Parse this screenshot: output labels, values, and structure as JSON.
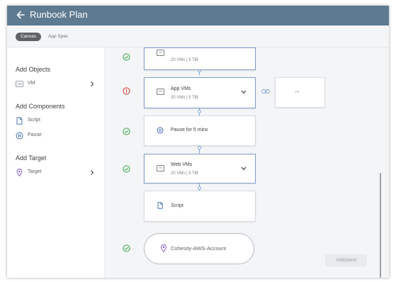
{
  "header": {
    "title": "Runbook Plan"
  },
  "tabs": [
    {
      "label": "Canvas",
      "active": true
    },
    {
      "label": "App Spec",
      "active": false
    }
  ],
  "sidebar": {
    "sections": [
      {
        "title": "Add Objects",
        "items": [
          {
            "label": "VM",
            "icon": "vm-icon",
            "has_chevron": true
          }
        ]
      },
      {
        "title": "Add Components",
        "items": [
          {
            "label": "Script",
            "icon": "script-file-icon"
          },
          {
            "label": "Pause",
            "icon": "pause-icon"
          }
        ]
      },
      {
        "title": "Add Target",
        "items": [
          {
            "label": "Target",
            "icon": "location-pin-icon",
            "has_chevron": true
          }
        ]
      }
    ]
  },
  "canvas": {
    "nodes": [
      {
        "title": "",
        "meta": "20 VMs  |  5 TiB",
        "status": "success",
        "icon": "vm-icon"
      },
      {
        "title": "App VMs",
        "meta": "20 VMs  |  5 TiB",
        "status": "error",
        "icon": "vm-icon",
        "expandable": true,
        "linked": true
      },
      {
        "title": "Pause for 5 mins",
        "meta": "",
        "status": "success",
        "icon": "pause-icon"
      },
      {
        "title": "Web VMs",
        "meta": "20 VMs  |  5 TiB",
        "status": "success",
        "icon": "vm-icon",
        "expandable": true
      },
      {
        "title": "Script",
        "meta": "",
        "status": "none",
        "icon": "script-file-icon"
      },
      {
        "title": "Cohesity-AWS-Account",
        "meta": "",
        "status": "success",
        "icon": "location-pin-icon"
      }
    ],
    "linked_box_label": "···",
    "vm_badge_text": "VM"
  },
  "footer": {
    "validate_button": "Validated"
  },
  "colors": {
    "header_bg": "#5d7a91",
    "success": "#3aa54f",
    "error": "#d9362b",
    "accent": "#4f82c4",
    "target": "#7d4fbf"
  }
}
